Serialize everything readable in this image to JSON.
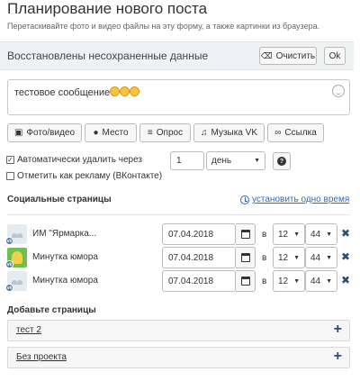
{
  "header": {
    "title": "Планирование нового поста",
    "hint": "Перетаскивайте фото и видео файлы на эту форму, а также картинки из браузера."
  },
  "restore": {
    "text": "Восстановлены несохраненные данные",
    "clear_label": "Очистить",
    "ok_label": "Ok"
  },
  "message": {
    "text": "тестовое сообщение",
    "emoji_count": 3,
    "emoji_icon": "grinning-face-emoji"
  },
  "toolbar": [
    {
      "name": "photo-video",
      "label": "Фото/видео",
      "icon": "image-icon"
    },
    {
      "name": "place",
      "label": "Место",
      "icon": "map-pin-icon"
    },
    {
      "name": "poll",
      "label": "Опрос",
      "icon": "poll-icon"
    },
    {
      "name": "music",
      "label": "Музыка VK",
      "icon": "music-note-icon"
    },
    {
      "name": "link",
      "label": "Ссылка",
      "icon": "link-icon"
    }
  ],
  "auto_delete": {
    "checked": true,
    "label": "Автоматически удалить через",
    "value": "1",
    "unit": "день"
  },
  "ad_mark": {
    "checked": false,
    "label": "Отметить как рекламу (ВКонтакте)"
  },
  "social": {
    "heading": "Социальные страницы",
    "set_one_time": "установить одно время",
    "in_label": "в",
    "pages": [
      {
        "name": "ИМ \"Ярмарка...",
        "avatar": "group-placeholder",
        "date": "07.04.2018",
        "hour": "12",
        "minute": "44"
      },
      {
        "name": "Минутка юмора",
        "avatar": "green-avatar",
        "date": "07.04.2018",
        "hour": "12",
        "minute": "44"
      },
      {
        "name": "Минутка юмора",
        "avatar": "group-placeholder",
        "date": "07.04.2018",
        "hour": "12",
        "minute": "44"
      }
    ]
  },
  "add_pages": {
    "heading": "Добавьте страницы",
    "groups": [
      {
        "label": "тест 2"
      },
      {
        "label": "Без проекта"
      }
    ]
  },
  "colors": {
    "accent": "#2a6ebb",
    "dark_icon": "#2a4d7a",
    "vk_blue": "#4a76a8",
    "bar_bg": "#eef2f3"
  }
}
